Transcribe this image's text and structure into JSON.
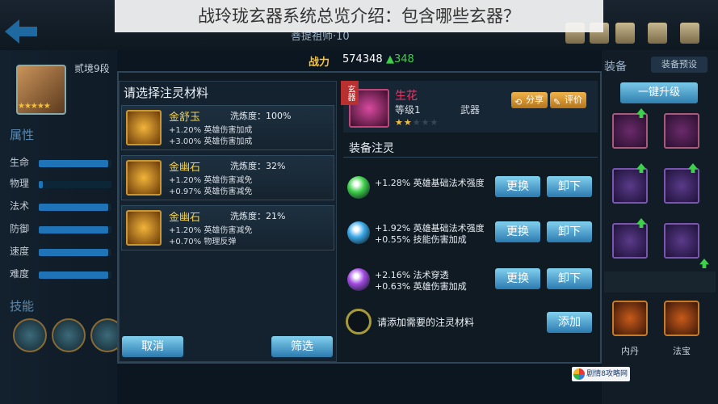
{
  "banner": {
    "title": "战玲珑玄器系统总览介绍：包含哪些玄器？"
  },
  "hero": {
    "name": "菩提祖师·10",
    "rank": "贰境9段"
  },
  "power": {
    "label": "战力",
    "value": "574348",
    "increase": "348"
  },
  "attributes": {
    "title": "属性",
    "rows": [
      {
        "label": "生命",
        "level": 0.95
      },
      {
        "label": "物理",
        "level": 0.05
      },
      {
        "label": "法术",
        "level": 0.95
      },
      {
        "label": "防御",
        "level": 0.95
      },
      {
        "label": "速度",
        "level": 0.95
      },
      {
        "label": "难度",
        "level": 0.95
      }
    ]
  },
  "skills": {
    "title": "技能"
  },
  "material_panel": {
    "title": "请选择注灵材料",
    "materials": [
      {
        "name": "金舒玉",
        "refine": "洗炼度：100%",
        "lines": [
          "+1.20% 英雄伤害加成",
          "+3.00% 英雄伤害加成"
        ]
      },
      {
        "name": "金幽石",
        "refine": "洗炼度：32%",
        "lines": [
          "+1.20% 英雄伤害减免",
          "+0.97% 英雄伤害减免"
        ]
      },
      {
        "name": "金幽石",
        "refine": "洗炼度：21%",
        "lines": [
          "+1.20% 英雄伤害减免",
          "+0.70% 物理反弹"
        ]
      }
    ],
    "cancel_label": "取消",
    "filter_label": "筛选"
  },
  "item": {
    "tag": "玄器",
    "name": "生花",
    "level": "等级1",
    "type": "武器",
    "stars_filled": 2,
    "stars_total": 5,
    "share_label": "分享",
    "review_label": "评价"
  },
  "infusion": {
    "title": "装备注灵",
    "slots": [
      {
        "lines": [
          "+1.28% 英雄基础法术强度"
        ],
        "gem_color": "#3ed04a",
        "replace_label": "更换",
        "remove_label": "卸下"
      },
      {
        "lines": [
          "+1.92% 英雄基础法术强度",
          "+0.55% 技能伤害加成"
        ],
        "gem_color": "#3aa8e8",
        "replace_label": "更换",
        "remove_label": "卸下"
      },
      {
        "lines": [
          "+2.16% 法术穿透",
          "+0.63% 英雄伤害加成"
        ],
        "gem_color": "#a04ae0",
        "replace_label": "更换",
        "remove_label": "卸下"
      }
    ],
    "empty_text": "请添加需要的注灵材料",
    "add_label": "添加"
  },
  "equipment": {
    "tab_label": "装备",
    "preset_label": "装备预设",
    "upgrade_label": "一键升级",
    "slot_labels": [
      "内丹",
      "法宝"
    ]
  },
  "watermark": {
    "text": "剧情8攻略网"
  },
  "colors": {
    "accent_blue": "#2b7ab0",
    "gold": "#f2d048",
    "item_name": "#e43a6a",
    "power": "#f5c342",
    "increase": "#3ed04a"
  }
}
